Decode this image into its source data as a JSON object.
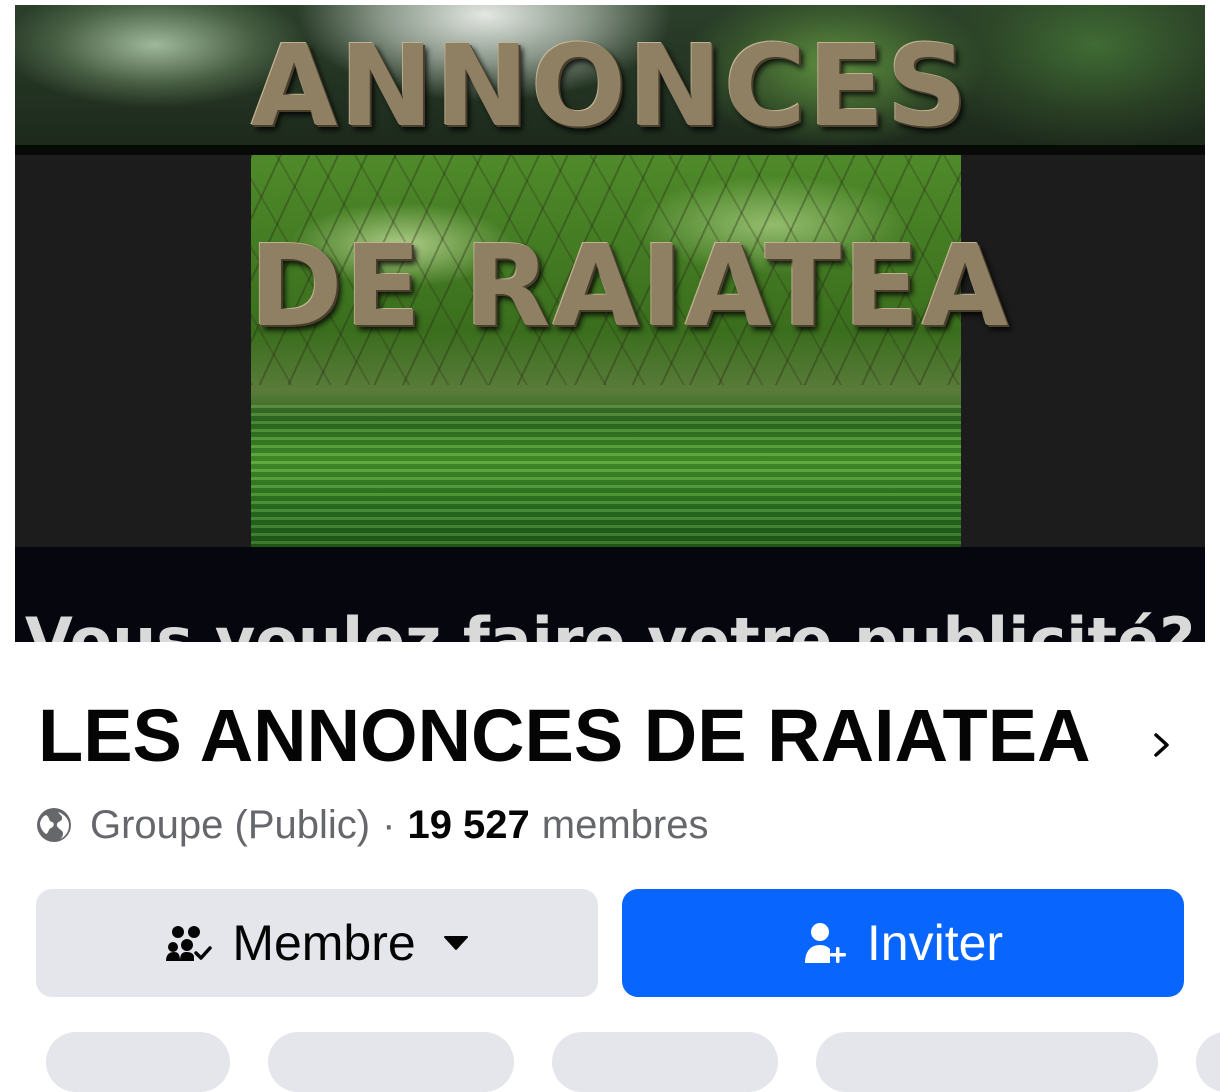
{
  "cover": {
    "line1": "ANNONCES",
    "line2": "DE RAIATEA",
    "line3": "Vous voulez faire votre publicité?"
  },
  "group": {
    "name": "LES ANNONCES DE RAIATEA",
    "type": "Groupe (Public)",
    "separator": "·",
    "member_count": "19 527",
    "members_word": "membres"
  },
  "actions": {
    "member_label": "Membre",
    "invite_label": "Inviter"
  },
  "icons": {
    "globe": "globe-icon",
    "chevron": "chevron-right-icon",
    "members": "members-check-icon",
    "caret": "caret-down-icon",
    "add_person": "add-person-icon"
  },
  "colors": {
    "primary_blue": "#0866ff",
    "secondary_gray": "#e4e6eb",
    "meta_gray": "#65676b",
    "text_dark": "#050505",
    "banner_gold": "#8f8063"
  }
}
